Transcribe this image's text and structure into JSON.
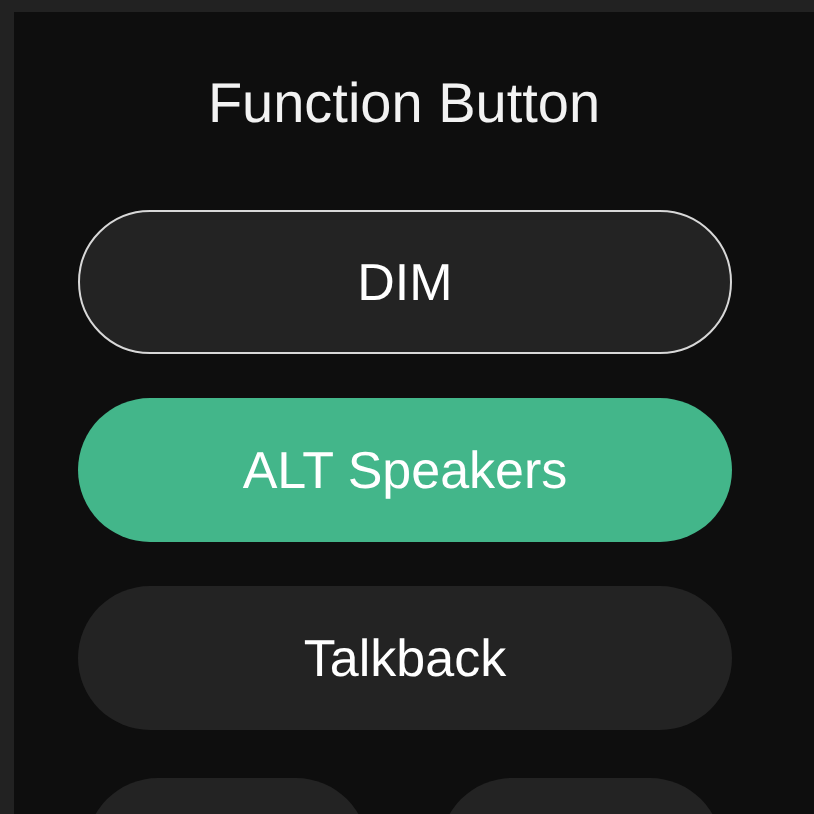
{
  "title": "Function Button",
  "buttons": [
    {
      "label": "DIM",
      "selected": false,
      "outlined": true
    },
    {
      "label": "ALT Speakers",
      "selected": true,
      "outlined": false
    },
    {
      "label": "Talkback",
      "selected": false,
      "outlined": false
    }
  ],
  "cut_buttons": [
    {
      "outlined": false
    },
    {
      "outlined": false
    }
  ]
}
